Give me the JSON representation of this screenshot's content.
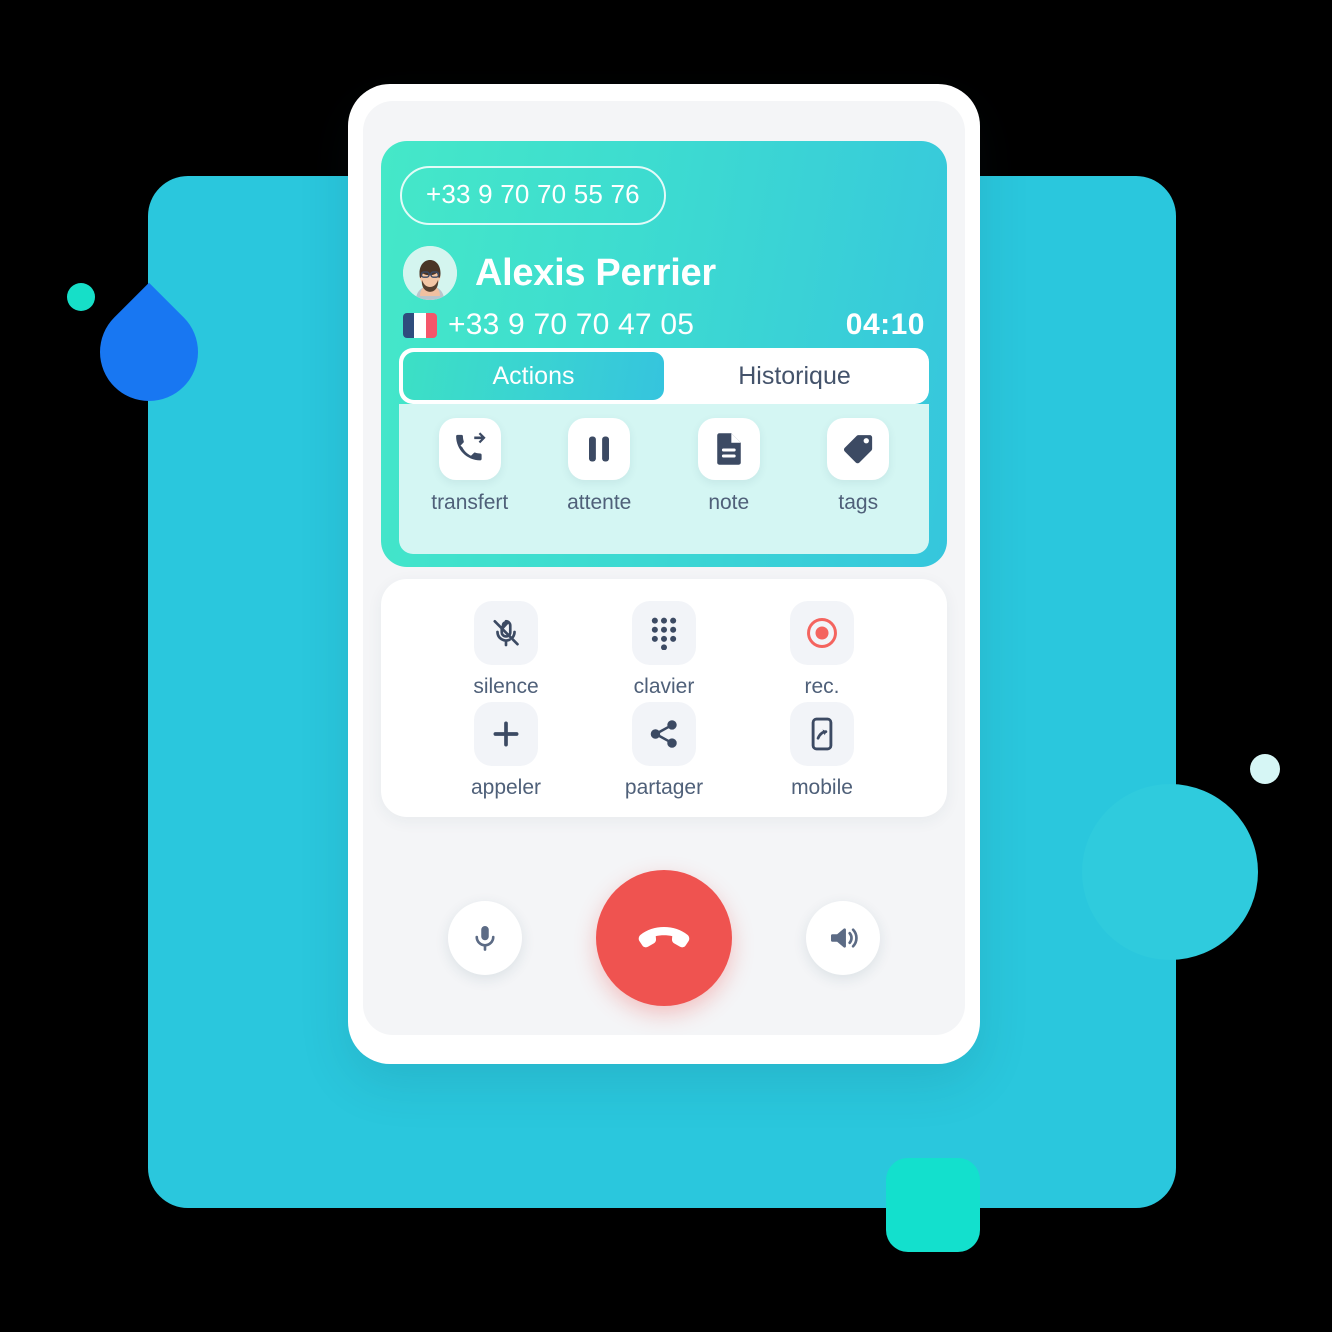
{
  "header": {
    "line_number": "+33 9 70 70 55 76",
    "contact_name": "Alexis Perrier",
    "contact_number": "+33 9 70 70 47 05",
    "timer": "04:10",
    "avatar_icon": "user-avatar-bearded-glasses",
    "flag_icon": "france-flag-icon",
    "gradient_from": "#45e8c8",
    "gradient_to": "#36c6dd"
  },
  "tabs": [
    {
      "label": "Actions",
      "active": true
    },
    {
      "label": "Historique",
      "active": false
    }
  ],
  "actions": [
    {
      "label": "transfert",
      "icon": "phone-forward-icon"
    },
    {
      "label": "attente",
      "icon": "pause-icon"
    },
    {
      "label": "note",
      "icon": "document-icon"
    },
    {
      "label": "tags",
      "icon": "tag-icon"
    }
  ],
  "controls": [
    {
      "label": "silence",
      "icon": "microphone-muted-icon"
    },
    {
      "label": "clavier",
      "icon": "dialpad-icon"
    },
    {
      "label": "rec.",
      "icon": "record-icon",
      "color": "#f4645f"
    },
    {
      "label": "appeler",
      "icon": "plus-icon"
    },
    {
      "label": "partager",
      "icon": "share-icon"
    },
    {
      "label": "mobile",
      "icon": "mobile-transfer-icon"
    }
  ],
  "bottom_bar": {
    "mic": {
      "icon": "microphone-icon"
    },
    "hangup": {
      "icon": "phone-hangup-icon",
      "color": "#ef5350"
    },
    "speaker": {
      "icon": "speaker-icon"
    }
  },
  "colors": {
    "background": "#2ac7dd",
    "panel_mint": "#d4f6f3",
    "icon_dark": "#3c4a63",
    "label_text": "#4f6079"
  }
}
